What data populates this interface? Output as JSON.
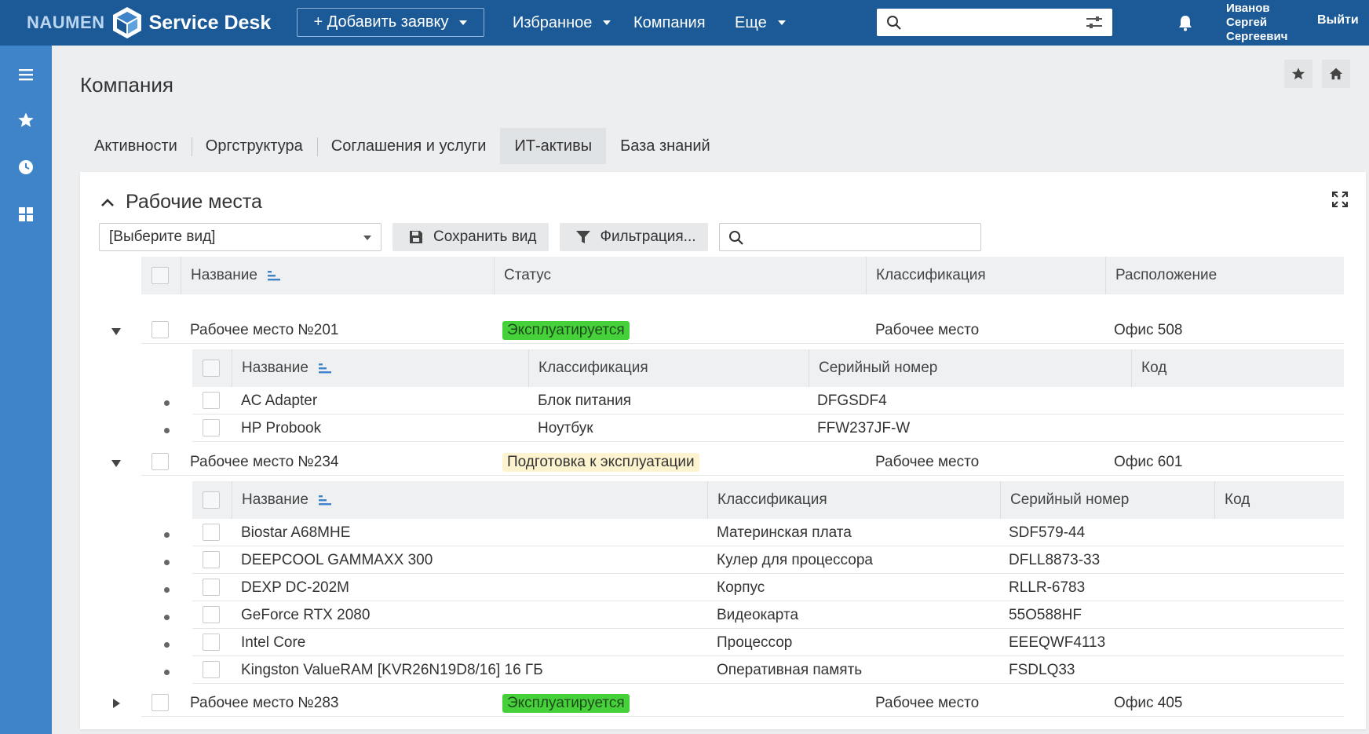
{
  "header": {
    "brand_left": "NAUMEN",
    "brand_right": "Service Desk",
    "add_button": "+ Добавить заявку",
    "nav": [
      "Избранное",
      "Компания",
      "Еще"
    ],
    "search_placeholder": "",
    "user_name_line1": "Иванов",
    "user_name_line2": "Сергей",
    "user_name_line3": "Сергеевич",
    "logout": "Выйти"
  },
  "sidebar": {
    "icons": [
      "menu-icon",
      "star-icon",
      "clock-icon",
      "grid-icon"
    ]
  },
  "page": {
    "title": "Компания",
    "tabs": [
      "Активности",
      "Оргструктура",
      "Соглашения и услуги",
      "ИТ-активы",
      "База знаний"
    ],
    "active_tab": "ИТ-активы"
  },
  "panel": {
    "title": "Рабочие места",
    "view_select": "[Выберите вид]",
    "save_view": "Сохранить вид",
    "filter": "Фильтрация...",
    "search_placeholder": ""
  },
  "main_table": {
    "columns": [
      "Название",
      "Статус",
      "Классификация",
      "Расположение"
    ],
    "rows": [
      {
        "name": "Рабочее место №201",
        "status": "Эксплуатируется",
        "classification": "Рабочее место",
        "location": "Офис 508",
        "expanded": true,
        "children": {
          "columns": [
            "Название",
            "Классификация",
            "Серийный номер",
            "Код"
          ],
          "rows": [
            {
              "name": "AC Adapter",
              "classification": "Блок питания",
              "serial": "DFGSDF4",
              "code": ""
            },
            {
              "name": "HP Probook",
              "classification": "Ноутбук",
              "serial": "FFW237JF-W",
              "code": ""
            }
          ]
        }
      },
      {
        "name": "Рабочее место №234",
        "status": "Подготовка к эксплуатации",
        "classification": "Рабочее место",
        "location": "Офис 601",
        "expanded": true,
        "children": {
          "columns": [
            "Название",
            "Классификация",
            "Серийный номер",
            "Код"
          ],
          "rows": [
            {
              "name": "Biostar A68MHE",
              "classification": "Материнская плата",
              "serial": "SDF579-44",
              "code": ""
            },
            {
              "name": "DEEPCOOL GAMMAXX 300",
              "classification": "Кулер для процессора",
              "serial": "DFLL8873-33",
              "code": ""
            },
            {
              "name": "DEXP DC-202M",
              "classification": "Корпус",
              "serial": "RLLR-6783",
              "code": ""
            },
            {
              "name": "GeForce RTX 2080",
              "classification": "Видеокарта",
              "serial": "55O588HF",
              "code": ""
            },
            {
              "name": "Intel Core",
              "classification": "Процессор",
              "serial": "EEEQWF4113",
              "code": ""
            },
            {
              "name": "Kingston ValueRAM [KVR26N19D8/16] 16 ГБ",
              "classification": "Оперативная память",
              "serial": "FSDLQ33",
              "code": ""
            }
          ]
        }
      },
      {
        "name": "Рабочее место №283",
        "status": "Эксплуатируется",
        "classification": "Рабочее место",
        "location": "Офис 405",
        "expanded": false
      }
    ]
  },
  "colors": {
    "topbar": "#1b5a96",
    "sidebar": "#3f84c8",
    "link": "#1a5fb4",
    "status_green": "#46d03a",
    "status_yellow": "#fdf3cf"
  }
}
